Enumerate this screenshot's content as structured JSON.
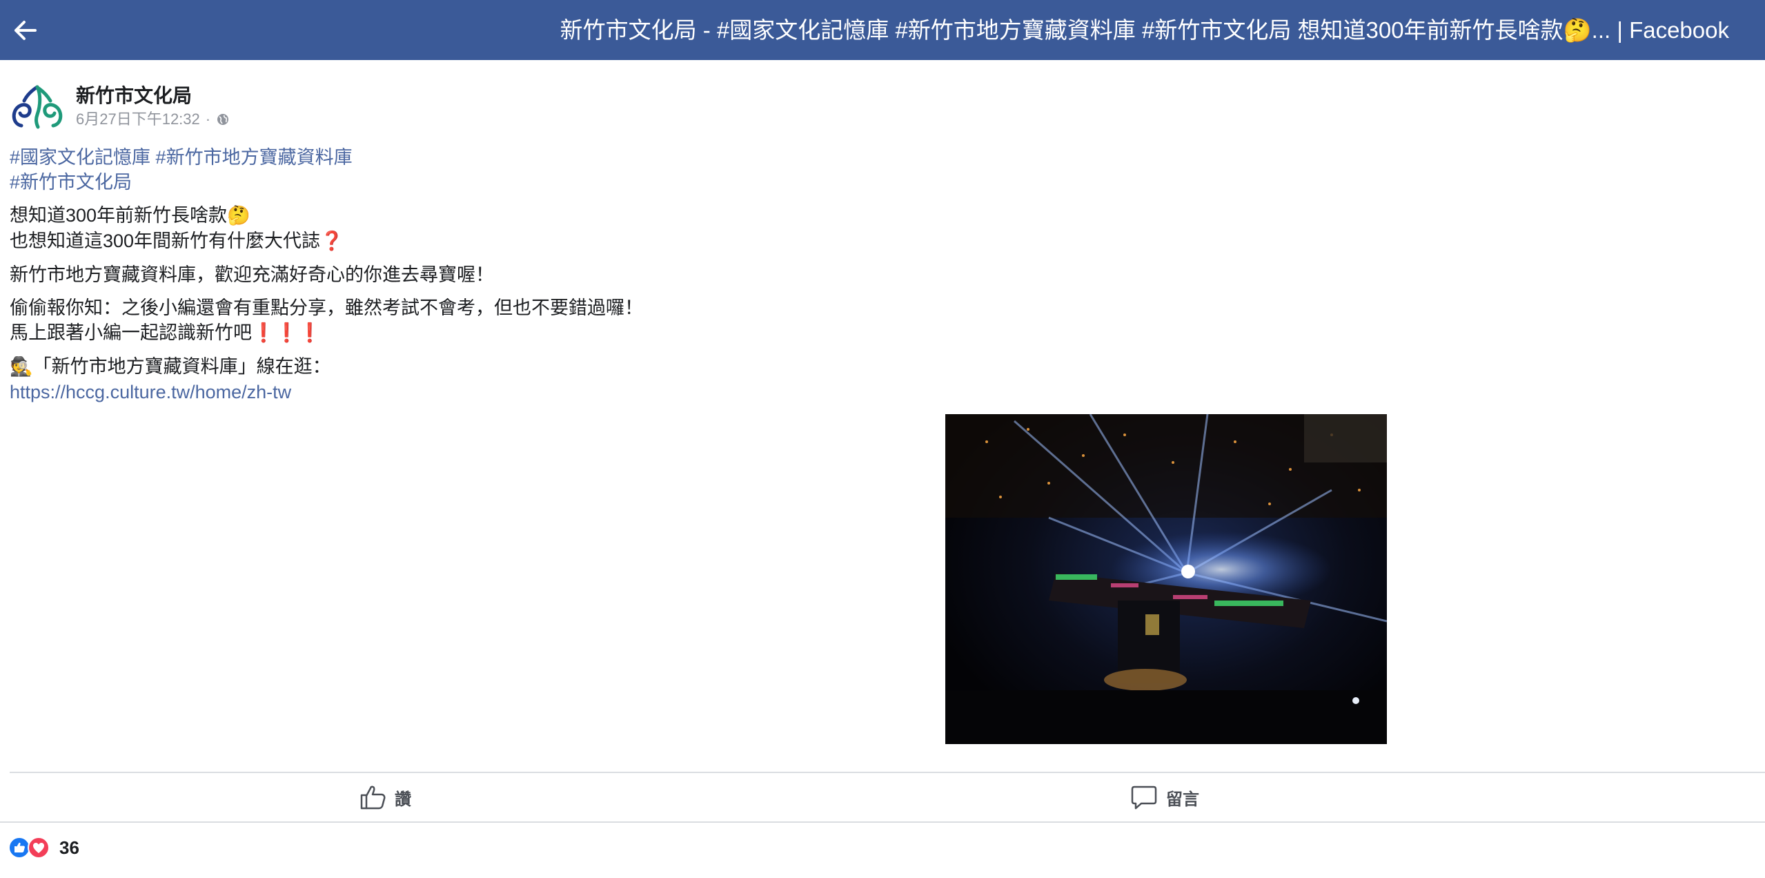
{
  "header": {
    "title": "新竹市文化局 - #國家文化記憶庫 #新竹市地方寶藏資料庫 #新竹市文化局 想知道300年前新竹長啥款🤔... | Facebook",
    "back_icon": "arrow-left-icon",
    "bar_color": "#3b5a98"
  },
  "post": {
    "page_name": "新竹市文化局",
    "timestamp": "6月27日下午12:32",
    "separator": "·",
    "privacy_icon": "globe-icon",
    "hashtags": [
      "#國家文化記憶庫",
      "#新竹市地方寶藏資料庫",
      "#新竹市文化局"
    ],
    "line1_text": "想知道300年前新竹長啥款",
    "line1_emoji": "🤔",
    "line2_text": "也想知道這300年間新竹有什麼大代誌",
    "line2_emoji": "❓",
    "line3": "新竹市地方寶藏資料庫，歡迎充滿好奇心的你進去尋寶喔！",
    "line4": "偷偷報你知：之後小編還會有重點分享，雖然考試不會考，但也不要錯過囉！",
    "line5_text": "馬上跟著小編一起認識新竹吧",
    "line5_emoji": "❗❗❗",
    "line6_emoji": "🕵",
    "line6_text": "「新竹市地方寶藏資料庫」線在逛：",
    "link": "https://hccg.culture.tw/home/zh-tw",
    "link_color": "#4b67a1"
  },
  "actions": {
    "like_label": "讚",
    "comment_label": "留言"
  },
  "reactions": {
    "count": "36",
    "icons": [
      "like-reaction-icon",
      "love-reaction-icon"
    ]
  }
}
